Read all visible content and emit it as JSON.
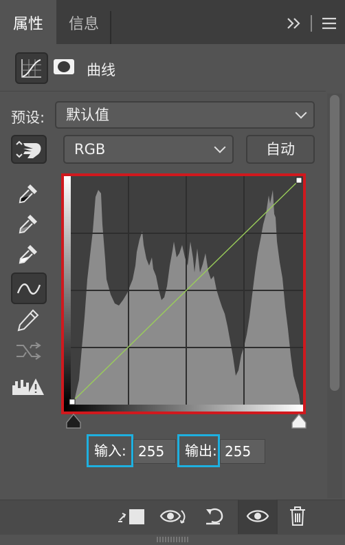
{
  "tabs": {
    "properties": "属性",
    "info": "信息"
  },
  "adjustment": {
    "title": "曲线",
    "curve_icon": "curves-adjustment-icon",
    "mask_icon": "layer-mask-icon"
  },
  "preset": {
    "label": "预设:",
    "value": "默认值"
  },
  "channel": {
    "value": "RGB"
  },
  "auto_button": "自动",
  "io": {
    "input_label": "输入:",
    "input_value": "255",
    "output_label": "输出:",
    "output_value": "255"
  },
  "colors": {
    "accent_red": "#d0191e",
    "highlight_blue": "#1eb0e0",
    "curve_green": "#9acd5a"
  },
  "tools": [
    "on-image-adjust-icon",
    "black-point-eyedropper-icon",
    "gray-point-eyedropper-icon",
    "white-point-eyedropper-icon",
    "curve-points-icon",
    "pencil-draw-icon",
    "smooth-curve-icon",
    "clipping-warning-icon"
  ],
  "bottom_icons": [
    "clip-to-layer-icon",
    "view-previous-state-icon",
    "reset-icon",
    "visibility-eye-icon",
    "trash-icon"
  ]
}
